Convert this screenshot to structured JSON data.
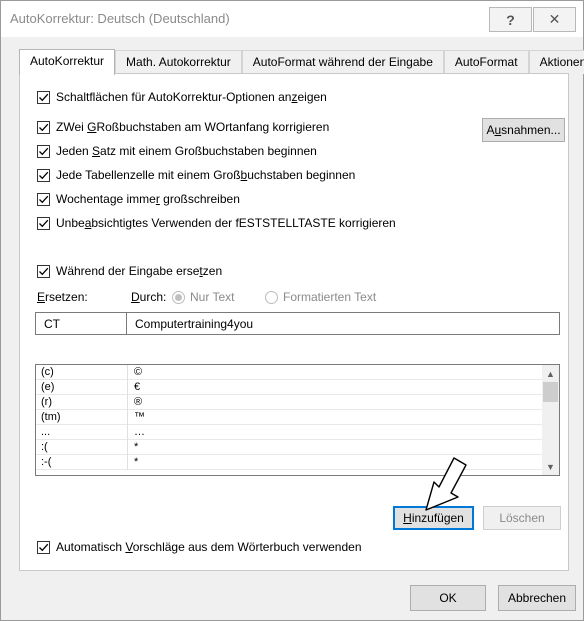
{
  "window": {
    "title": "AutoKorrektur: Deutsch (Deutschland)",
    "help_glyph": "?",
    "close_glyph": "✕"
  },
  "tabs": [
    {
      "label": "AutoKorrektur",
      "active": true
    },
    {
      "label": "Math. Autokorrektur"
    },
    {
      "label": "AutoFormat während der Eingabe"
    },
    {
      "label": "AutoFormat"
    },
    {
      "label": "Aktionen"
    }
  ],
  "options": {
    "show_buttons": {
      "pre": "Schaltflächen für AutoKorrektur-Optionen an",
      "u": "z",
      "post": "eigen",
      "checked": true
    },
    "two_caps": {
      "pre": "ZWei ",
      "u": "G",
      "post": "Roßbuchstaben am WOrtanfang korrigieren",
      "checked": true
    },
    "sentence": {
      "pre": "Jeden ",
      "u": "S",
      "post": "atz mit einem Großbuchstaben beginnen",
      "checked": true
    },
    "table_cell": {
      "pre": "Jede Tabellenzelle mit einem Groß",
      "u": "b",
      "post": "uchstaben beginnen",
      "checked": true
    },
    "weekdays": {
      "pre": "Wochentage imme",
      "u": "r",
      "post": " großschreiben",
      "checked": true
    },
    "caps_lock": {
      "pre": "Unbe",
      "u": "a",
      "post": "bsichtigtes Verwenden der fESTSTELLTASTE korrigieren",
      "checked": true
    },
    "replace_while_typing": {
      "pre": "Während der Eingabe erse",
      "u": "t",
      "post": "zen",
      "checked": true
    },
    "dictionary": {
      "pre": "Automatisch ",
      "u": "V",
      "post": "orschläge aus dem Wörterbuch verwenden",
      "checked": true
    }
  },
  "exceptions_button": {
    "pre": "A",
    "u": "u",
    "post": "snahmen..."
  },
  "replace": {
    "replace_label": {
      "u": "E",
      "post": "rsetzen:"
    },
    "with_label": {
      "u": "D",
      "post": "urch:"
    },
    "radio_plain": "Nur Text",
    "radio_formatted": "Formatierten Text",
    "replace_value": "CT",
    "with_value": "Computertraining4you"
  },
  "list": {
    "rows": [
      {
        "from": "(c)",
        "to": "©"
      },
      {
        "from": "(e)",
        "to": "€"
      },
      {
        "from": "(r)",
        "to": "®"
      },
      {
        "from": "(tm)",
        "to": "™"
      },
      {
        "from": "...",
        "to": "…"
      },
      {
        "from": ":(",
        "to": "*"
      },
      {
        "from": ":-(",
        "to": "*"
      }
    ],
    "scroll_up": "▲",
    "scroll_down": "▼"
  },
  "add_button": {
    "u": "H",
    "post": "inzufügen"
  },
  "delete_button": "Löschen",
  "footer": {
    "ok": "OK",
    "cancel": "Abbrechen"
  },
  "colors": {
    "accent": "#0078d7",
    "disabled_text": "#8a8a8a"
  }
}
